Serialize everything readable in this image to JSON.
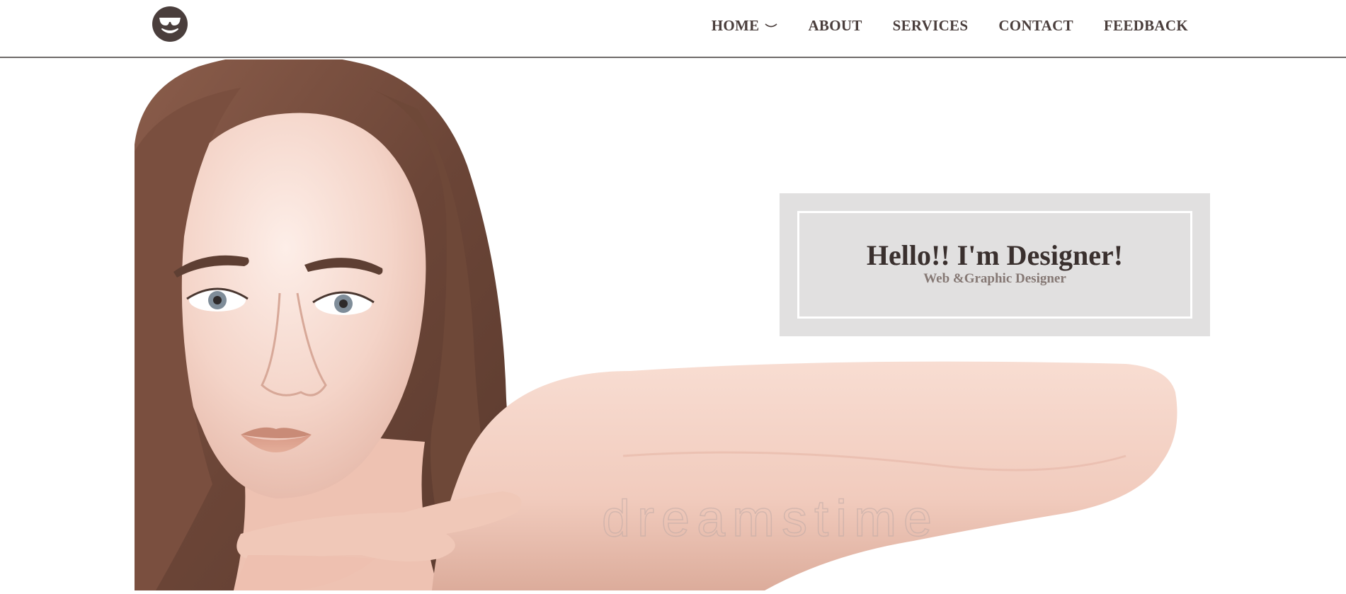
{
  "nav": {
    "logo_icon": "sunglasses-smiley-icon",
    "items": [
      {
        "label": "HOME",
        "icon": "chevron-down-icon"
      },
      {
        "label": "ABOUT"
      },
      {
        "label": "SERVICES"
      },
      {
        "label": "CONTACT"
      },
      {
        "label": "FEEDBACK"
      }
    ]
  },
  "hero": {
    "image": "woman-portrait-photo",
    "watermark": "dreamstime",
    "title": "Hello!! I'm Designer!",
    "subtitle": "Web &Graphic Designer"
  },
  "colors": {
    "nav_text": "#4a3e3c",
    "logo": "#4a3e3c",
    "box_bg": "#e1e0e0",
    "title": "#3a302e",
    "subtitle": "#857874"
  }
}
